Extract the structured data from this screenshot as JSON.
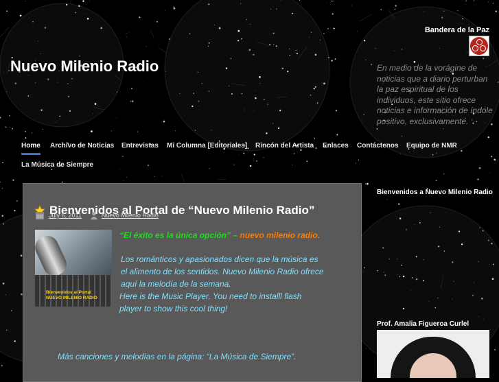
{
  "header": {
    "site_title": "Nuevo Milenio Radio",
    "flag_label": "Bandera de la Paz",
    "flag_icon": "banner-of-peace-icon",
    "tagline": "En medio de la vorágine de noticias que a diario perturban la paz espiritual de los individuos, este sitio ofrece noticias e información de índole positivo, exclusivamente."
  },
  "nav": {
    "items": [
      {
        "label": "Home",
        "active": true
      },
      {
        "label": "Archivo de Noticias"
      },
      {
        "label": "Entrevistas"
      },
      {
        "label": "Mi Columna [Editoriales]"
      },
      {
        "label": "Rincón del Artista"
      },
      {
        "label": "Enlaces"
      },
      {
        "label": "Contáctenos"
      },
      {
        "label": "Equipo de NMR"
      },
      {
        "label": "La Música de Siempre"
      }
    ],
    "active_color": "#3a6fcf"
  },
  "post": {
    "title": "Bienvenidos al Portal de “Nuevo Milenio Radio”",
    "date": "July 6, 2011",
    "author": "Nuevo Milenio Radio",
    "image_caption": "Bienvenidos al Portal\nNUEVO MILENIO RADIO",
    "quote_part": "“El éxito es la única opción” –",
    "quote_brand": "nuevo milenio radio.",
    "body_line1": "Los románticos y apasionados dicen que la música es el alimento de los sentidos. Nuevo Milenio Radio ofrece aquí la melodía de la semana.",
    "body_line2": "Here is the Music Player. You need to installl flash player to show this cool thing!",
    "more_text": "Más canciones y melodías en la página: “La Música de Siempre”."
  },
  "sidebar": {
    "welcome_title": "Bienvenidos a Nuevo Milenio Radio",
    "profile_title": "Prof. Amalia Figueroa Curiel"
  },
  "colors": {
    "post_bg": "#595959",
    "quote_green": "#19e019",
    "quote_orange": "#ff7a00",
    "body_cyan": "#7fe0ff"
  }
}
